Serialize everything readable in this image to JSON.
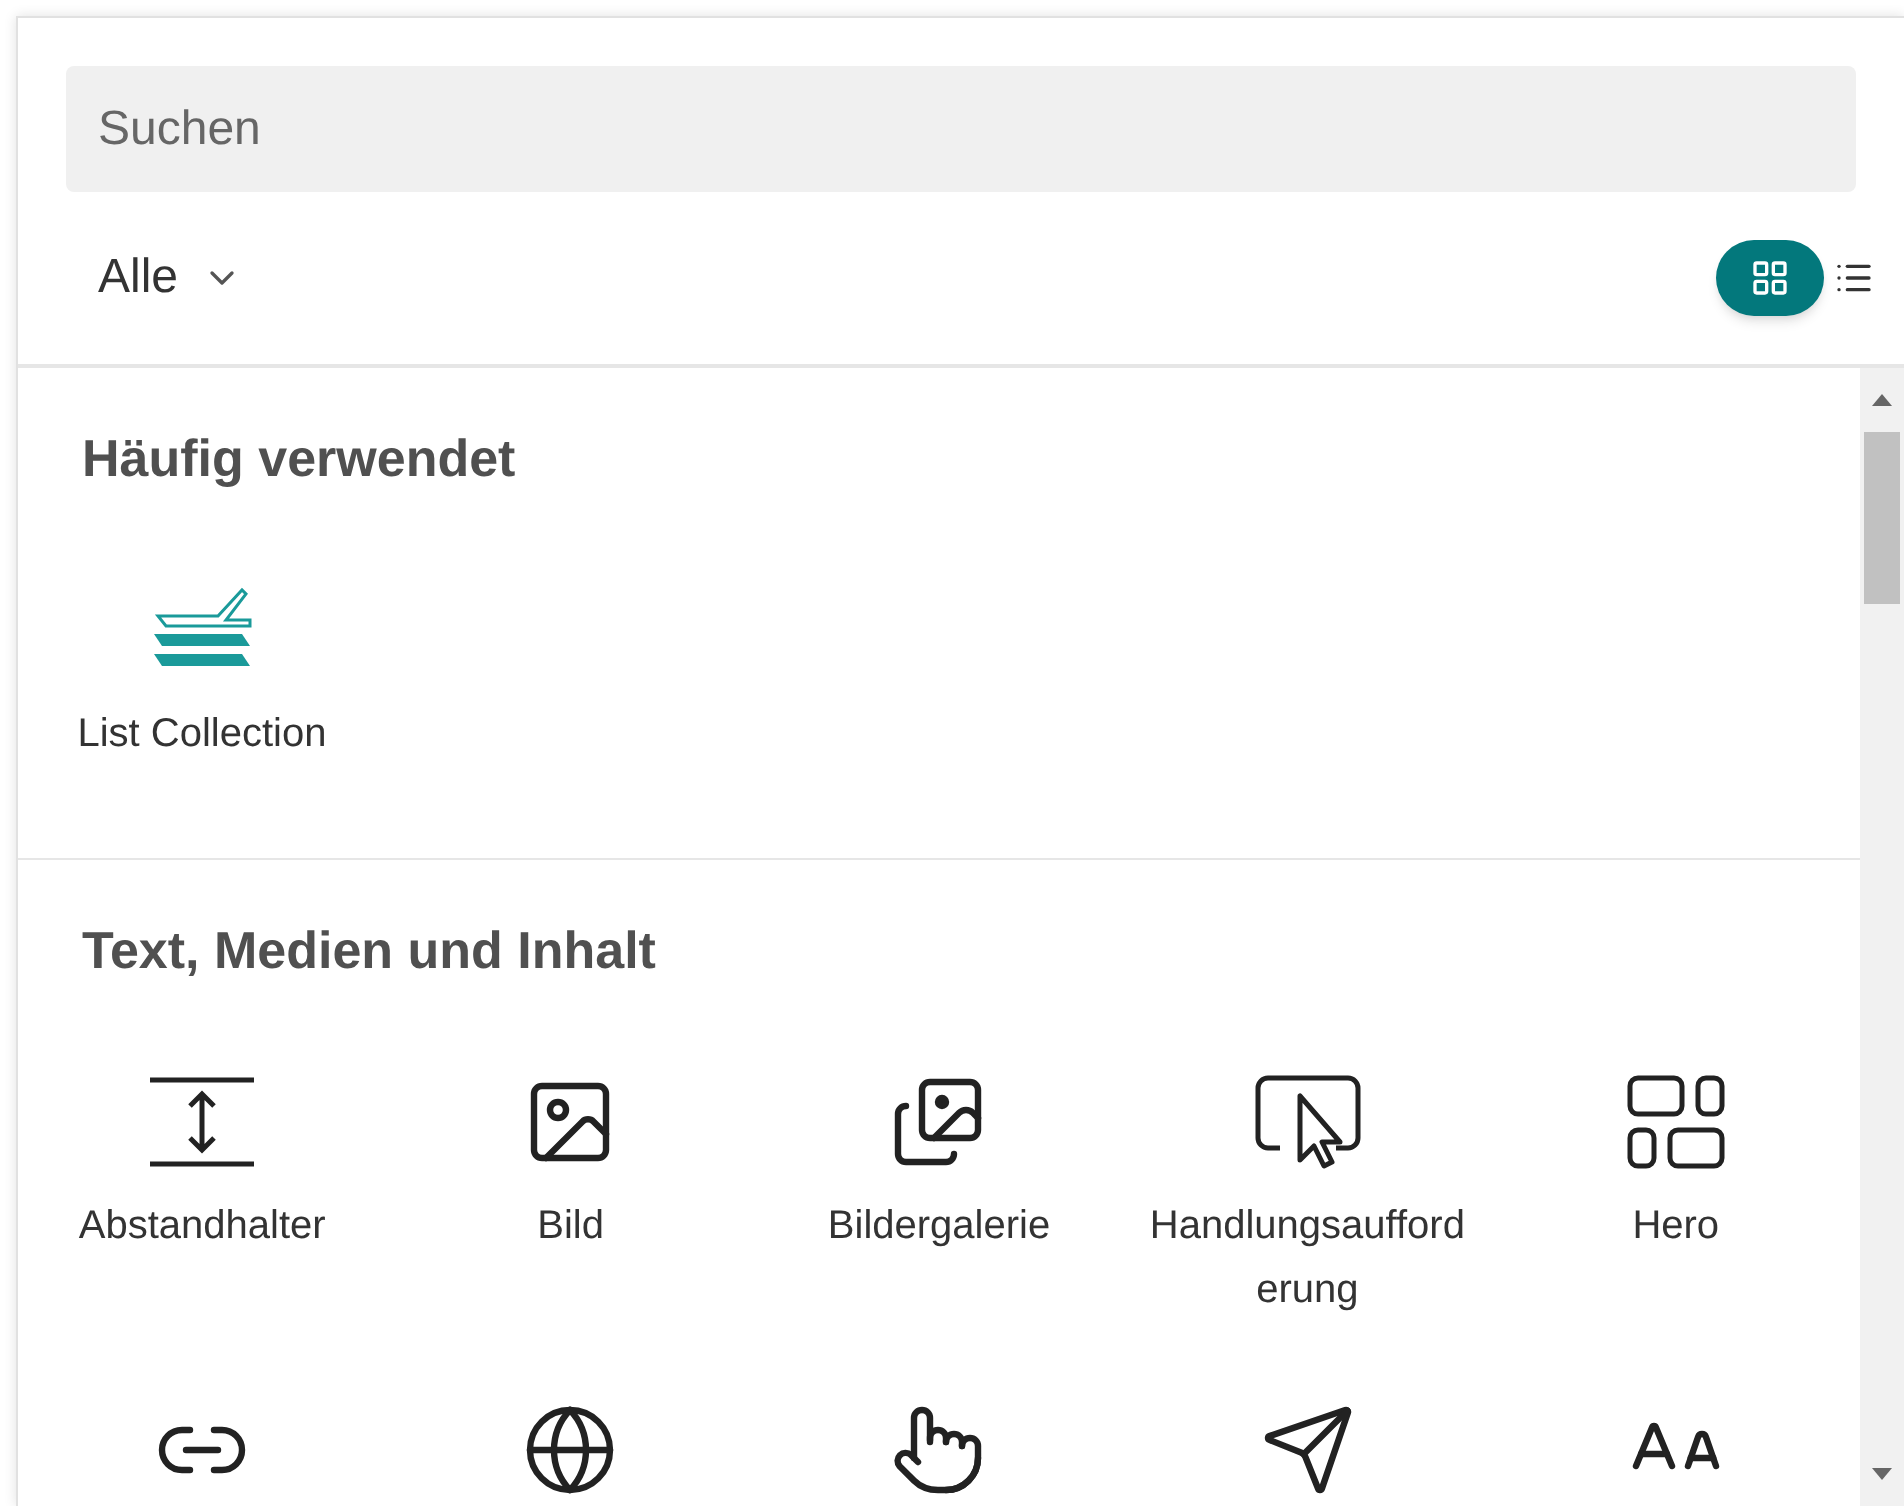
{
  "search": {
    "placeholder": "Suchen"
  },
  "filter": {
    "label": "Alle"
  },
  "views": [
    {
      "kind": "grid",
      "selected": true
    },
    {
      "kind": "list",
      "selected": false
    }
  ],
  "sections": [
    {
      "title": "Häufig verwendet",
      "items": [
        {
          "kind": "list-collection",
          "label": "List Collection"
        }
      ]
    },
    {
      "title": "Text, Medien und Inhalt",
      "items": [
        {
          "kind": "spacer",
          "label": "Abstandhalter"
        },
        {
          "kind": "image",
          "label": "Bild"
        },
        {
          "kind": "gallery",
          "label": "Bildergalerie"
        },
        {
          "kind": "call-to-action",
          "label": "Handlungsaufforderung"
        },
        {
          "kind": "hero",
          "label": "Hero"
        },
        {
          "kind": "link"
        },
        {
          "kind": "globe"
        },
        {
          "kind": "hand"
        },
        {
          "kind": "plane"
        },
        {
          "kind": "text-size"
        }
      ]
    }
  ]
}
